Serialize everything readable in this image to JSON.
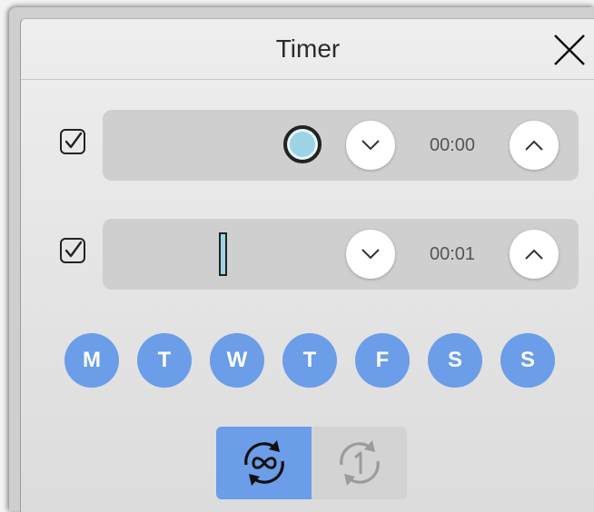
{
  "window": {
    "title": "Timer"
  },
  "rows": [
    {
      "checked": true,
      "shape": "circle",
      "time": "00:00"
    },
    {
      "checked": true,
      "shape": "line",
      "time": "00:01"
    }
  ],
  "days": [
    "M",
    "T",
    "W",
    "T",
    "F",
    "S",
    "S"
  ],
  "mode": {
    "selected": "repeat"
  },
  "colors": {
    "accent": "#6b9de8",
    "shape_fill": "#9dd3e4",
    "panel": "#cfcfcf"
  }
}
